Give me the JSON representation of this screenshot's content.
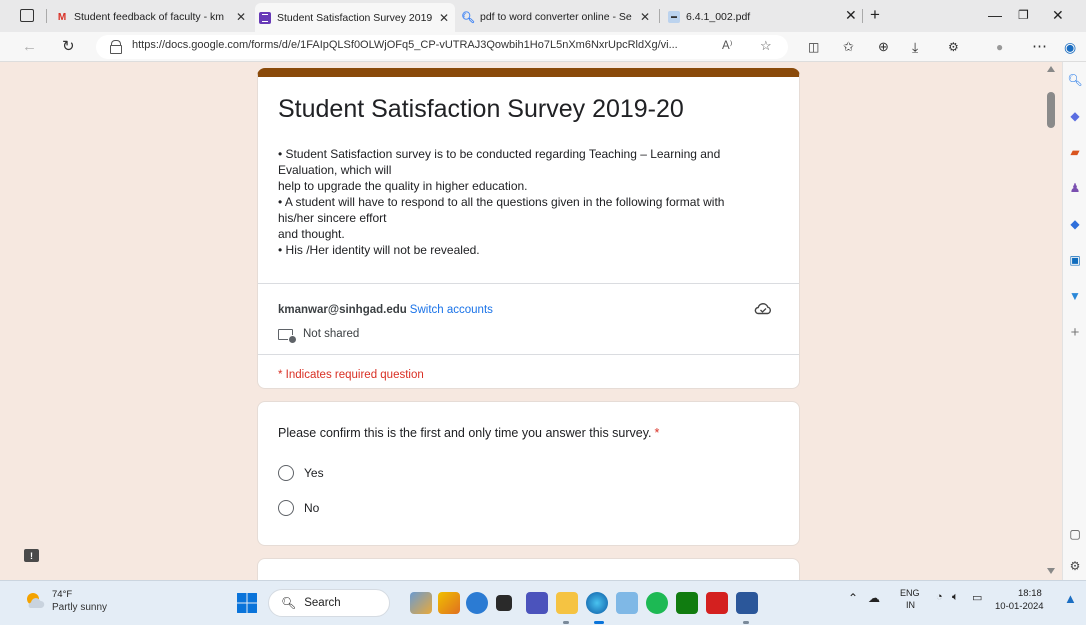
{
  "browser": {
    "tabs": [
      {
        "title": "Student feedback of faculty - km",
        "icon": "gmail-icon",
        "active": false
      },
      {
        "title": "Student Satisfaction Survey 2019",
        "icon": "google-forms-icon",
        "active": true
      },
      {
        "title": "pdf to word converter online - Se",
        "icon": "search-icon",
        "active": false
      },
      {
        "title": "6.4.1_002.pdf",
        "icon": "pdf-icon",
        "active": false
      }
    ],
    "url": "https://docs.google.com/forms/d/e/1FAIpQLSf0OLWjOFq5_CP-vUTRAJ3Qowbih1Ho7L5nXm6NxrUpcRldXg/vi...",
    "reader_label": "A⁾"
  },
  "form": {
    "title": "Student Satisfaction Survey 2019-20",
    "description": [
      "•      Student Satisfaction survey is to be conducted regarding Teaching – Learning and",
      "Evaluation, which will",
      "          help to upgrade the quality in higher education.",
      "•      A student will have to respond to all the questions given in the following format with",
      "his/her sincere effort",
      "         and thought.",
      "•      His /Her identity will not be revealed."
    ],
    "account_email": "kmanwar@sinhgad.edu",
    "switch_accounts": "Switch accounts",
    "not_shared": "Not shared",
    "required_note": "* Indicates required question"
  },
  "question1": {
    "text": "Please confirm this is the first and only time you answer this survey.",
    "required_mark": "*",
    "options": [
      "Yes",
      "No"
    ]
  },
  "taskbar": {
    "weather_temp": "74°F",
    "weather_desc": "Partly sunny",
    "search_label": "Search",
    "lang_top": "ENG",
    "lang_bottom": "IN",
    "time": "18:18",
    "date": "10-01-2024"
  },
  "colors": {
    "form_accent": "#8a4a0a",
    "page_background": "#f6e8e0",
    "required_red": "#d93025",
    "link_blue": "#1a73e8"
  }
}
